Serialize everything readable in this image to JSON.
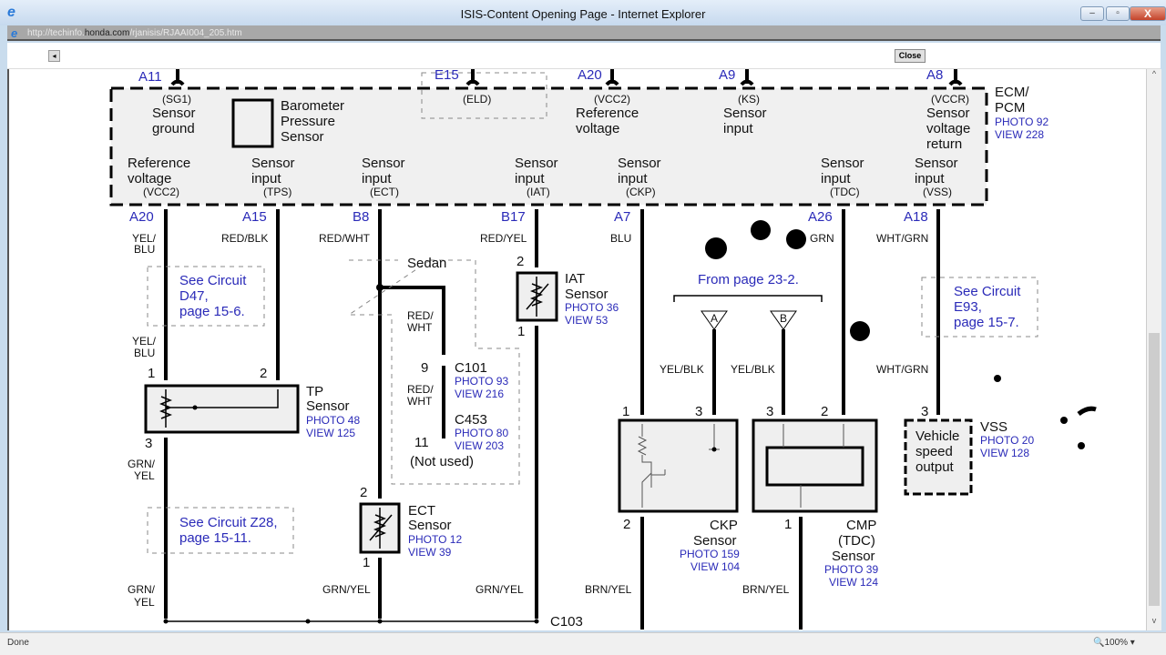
{
  "window": {
    "title": "ISIS-Content Opening Page - Internet Explorer",
    "url_prefix": "http://techinfo.",
    "url_domain": "honda.com",
    "url_path": "/rjanisis/RJAAI004_205.htm",
    "minimize": "–",
    "restore": "▫",
    "close": "X"
  },
  "toolbar": {
    "back": "◂",
    "close_label": "Close"
  },
  "status": {
    "text": "Done",
    "zoom": "🔍100% ▾"
  },
  "scrollbar": {
    "up": "^",
    "down": "v"
  },
  "diagram": {
    "ecm": {
      "name1": "ECM/",
      "name2": "PCM",
      "photo": "PHOTO 92",
      "view": "VIEW 228"
    },
    "top_pins": {
      "a11": "A11",
      "e15": "E15",
      "a20": "A20",
      "a9": "A9",
      "a8": "A8"
    },
    "top_terms": {
      "sg1": {
        "code": "(SG1)",
        "l1": "Sensor",
        "l2": "ground"
      },
      "baro": {
        "l1": "Barometer",
        "l2": "Pressure",
        "l3": "Sensor"
      },
      "eld": {
        "code": "(ELD)"
      },
      "vcc2": {
        "code": "(VCC2)",
        "l1": "Reference",
        "l2": "voltage"
      },
      "ks": {
        "code": "(KS)",
        "l1": "Sensor",
        "l2": "input"
      },
      "vccr": {
        "code": "(VCCR)",
        "l1": "Sensor",
        "l2": "voltage",
        "l3": "return"
      }
    },
    "bottom_terms": {
      "vcc2": {
        "l1": "Reference",
        "l2": "voltage",
        "code": "(VCC2)"
      },
      "tps": {
        "l1": "Sensor",
        "l2": "input",
        "code": "(TPS)"
      },
      "ect": {
        "l1": "Sensor",
        "l2": "input",
        "code": "(ECT)"
      },
      "iat": {
        "l1": "Sensor",
        "l2": "input",
        "code": "(IAT)"
      },
      "ckp": {
        "l1": "Sensor",
        "l2": "input",
        "code": "(CKP)"
      },
      "tdc": {
        "l1": "Sensor",
        "l2": "input",
        "code": "(TDC)"
      },
      "vss": {
        "l1": "Sensor",
        "l2": "input",
        "code": "(VSS)"
      }
    },
    "bottom_pins": {
      "a20": "A20",
      "a15": "A15",
      "b8": "B8",
      "b17": "B17",
      "a7": "A7",
      "a26": "A26",
      "a18": "A18"
    },
    "wires": {
      "yel_blu": "YEL/",
      "blu": "BLU",
      "red_blk": "RED/BLK",
      "red_wht": "RED/WHT",
      "red_yel": "RED/YEL",
      "blu_a7": "BLU",
      "grn": "GRN",
      "wht_grn": "WHT/GRN",
      "red_slash": "RED/",
      "wht": "WHT",
      "grn_slash": "GRN/",
      "yel": "YEL",
      "grn_yel": "GRN/YEL",
      "yel_blk": "YEL/BLK",
      "brn_yel": "BRN/YEL"
    },
    "see_d47": {
      "l1": "See Circuit",
      "l2": "D47,",
      "l3": "page 15-6."
    },
    "see_z28": {
      "l1": "See Circuit Z28,",
      "l2": "page 15-11."
    },
    "see_e93": {
      "l1": "See Circuit",
      "l2": "E93,",
      "l3": "page 15-7."
    },
    "tp": {
      "name": "TP",
      "l2": "Sensor",
      "photo": "PHOTO 48",
      "view": "VIEW 125",
      "pin1": "1",
      "pin2": "2",
      "pin3": "3"
    },
    "sedan": "Sedan",
    "c101": {
      "name": "C101",
      "photo": "PHOTO 93",
      "view": "VIEW 216",
      "pin": "9"
    },
    "c453": {
      "name": "C453",
      "photo": "PHOTO 80",
      "view": "VIEW 203",
      "pin": "11",
      "note": "(Not used)"
    },
    "ect": {
      "name": "ECT",
      "l2": "Sensor",
      "photo": "PHOTO 12",
      "view": "VIEW 39",
      "pin2": "2",
      "pin1": "1"
    },
    "iat": {
      "name": "IAT",
      "l2": "Sensor",
      "photo": "PHOTO 36",
      "view": "VIEW 53",
      "pin2": "2",
      "pin1": "1"
    },
    "c103": "C103",
    "from_page": "From page 23-2.",
    "tri_a": "A",
    "tri_b": "B",
    "ckp": {
      "name": "CKP",
      "l2": "Sensor",
      "photo": "PHOTO 159",
      "view": "VIEW 104",
      "pin1": "1",
      "pin3": "3",
      "pin2": "2"
    },
    "cmp": {
      "name": "CMP",
      "l2": "(TDC)",
      "l3": "Sensor",
      "photo": "PHOTO 39",
      "view": "VIEW 124",
      "pin3": "3",
      "pin2": "2",
      "pin1": "1"
    },
    "vss": {
      "l1": "Vehicle",
      "l2": "speed",
      "l3": "output",
      "name": "VSS",
      "photo": "PHOTO 20",
      "view": "VIEW 128",
      "pin3": "3"
    }
  }
}
